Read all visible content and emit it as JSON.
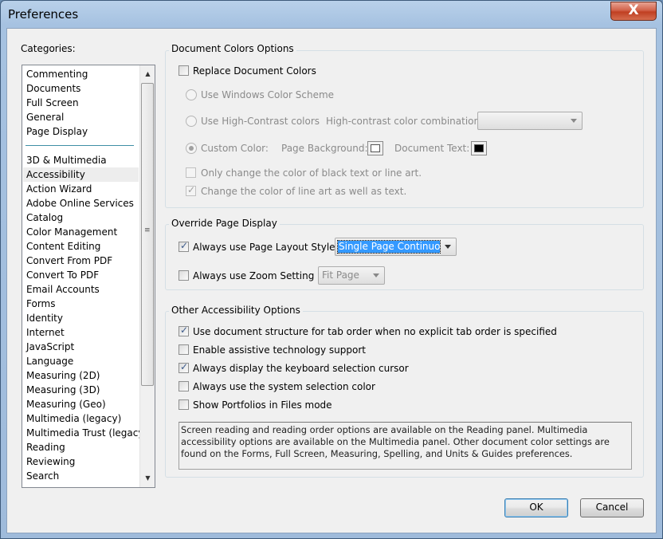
{
  "window": {
    "title": "Preferences",
    "close_label": "X"
  },
  "categories": {
    "label": "Categories:",
    "top_items": [
      "Commenting",
      "Documents",
      "Full Screen",
      "General",
      "Page Display"
    ],
    "items": [
      "3D & Multimedia",
      "Accessibility",
      "Action Wizard",
      "Adobe Online Services",
      "Catalog",
      "Color Management",
      "Content Editing",
      "Convert From PDF",
      "Convert To PDF",
      "Email Accounts",
      "Forms",
      "Identity",
      "Internet",
      "JavaScript",
      "Language",
      "Measuring (2D)",
      "Measuring (3D)",
      "Measuring (Geo)",
      "Multimedia (legacy)",
      "Multimedia Trust (legacy)",
      "Reading",
      "Reviewing",
      "Search"
    ],
    "selected": "Accessibility"
  },
  "doc_colors": {
    "title": "Document Colors Options",
    "replace_label": "Replace Document Colors",
    "replace_checked": false,
    "use_windows_label": "Use Windows Color Scheme",
    "use_high_contrast_label": "Use High-Contrast colors",
    "hc_combo_label": "High-contrast color combination:",
    "hc_combo_value": "",
    "custom_label": "Custom Color:",
    "page_bg_label": "Page Background:",
    "doc_text_label": "Document Text:",
    "page_bg_color": "#ffffff",
    "doc_text_color": "#000000",
    "only_black_label": "Only change the color of black text or line art.",
    "only_black_checked": false,
    "line_art_label": "Change the color of line art as well as text.",
    "line_art_checked": true
  },
  "override": {
    "title": "Override Page Display",
    "layout_label": "Always use Page Layout Style",
    "layout_checked": true,
    "layout_value": "Single Page Continuous",
    "zoom_label": "Always use Zoom Setting",
    "zoom_checked": false,
    "zoom_value": "Fit Page"
  },
  "other": {
    "title": "Other Accessibility Options",
    "options": [
      {
        "label": "Use document structure for tab order when no explicit tab order is specified",
        "checked": true
      },
      {
        "label": "Enable assistive technology support",
        "checked": false
      },
      {
        "label": "Always display the keyboard selection cursor",
        "checked": true
      },
      {
        "label": "Always use the system selection color",
        "checked": false
      },
      {
        "label": "Show Portfolios in Files mode",
        "checked": false
      }
    ],
    "note": "Screen reading and reading order options are available on the Reading panel. Multimedia accessibility options are available on the Multimedia panel. Other document color settings are found on the Forms, Full Screen, Measuring, Spelling, and Units & Guides preferences."
  },
  "buttons": {
    "ok": "OK",
    "cancel": "Cancel"
  }
}
